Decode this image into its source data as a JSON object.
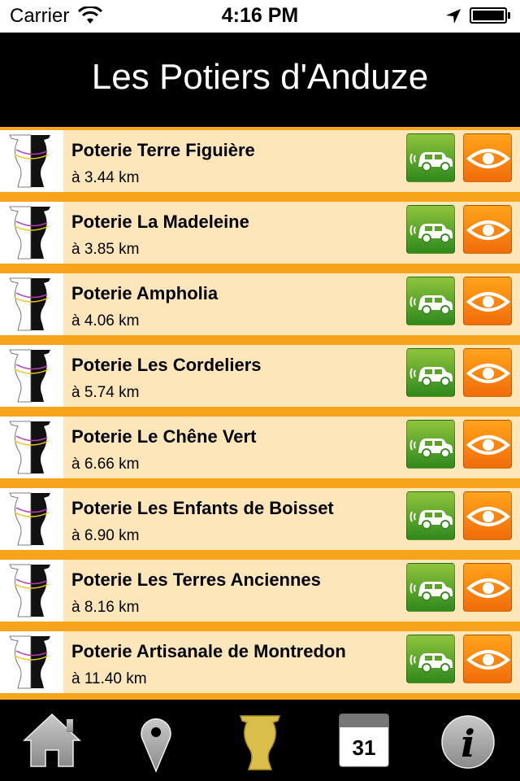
{
  "status_bar": {
    "carrier": "Carrier",
    "time": "4:16 PM"
  },
  "header": {
    "title": "Les Potiers d'Anduze"
  },
  "potteries": [
    {
      "name": "Poterie Terre Figuière",
      "distance": "à 3.44 km"
    },
    {
      "name": "Poterie La Madeleine",
      "distance": "à 3.85 km"
    },
    {
      "name": "Poterie Ampholia",
      "distance": "à 4.06 km"
    },
    {
      "name": "Poterie Les Cordeliers",
      "distance": "à 5.74 km"
    },
    {
      "name": "Poterie Le Chêne Vert",
      "distance": "à 6.66 km"
    },
    {
      "name": "Poterie Les Enfants de Boisset",
      "distance": "à 6.90 km"
    },
    {
      "name": "Poterie Les Terres Anciennes",
      "distance": "à 8.16 km"
    },
    {
      "name": "Poterie Artisanale de Montredon",
      "distance": "à 11.40 km"
    }
  ],
  "row_buttons": {
    "directions_icon": "car-icon",
    "view_icon": "eye-icon"
  },
  "tabbar": {
    "tabs": [
      {
        "icon": "home-icon"
      },
      {
        "icon": "map-pin-icon"
      },
      {
        "icon": "vase-icon",
        "selected": true
      },
      {
        "icon": "calendar-icon",
        "label": "31"
      },
      {
        "icon": "info-icon"
      }
    ]
  },
  "colors": {
    "header_bg": "#000000",
    "row_bg": "#fde6b9",
    "separator": "#f7a41b",
    "car_button": "#5aa22a",
    "eye_button": "#f7890f",
    "selected_tab": "#d9bf4a"
  }
}
